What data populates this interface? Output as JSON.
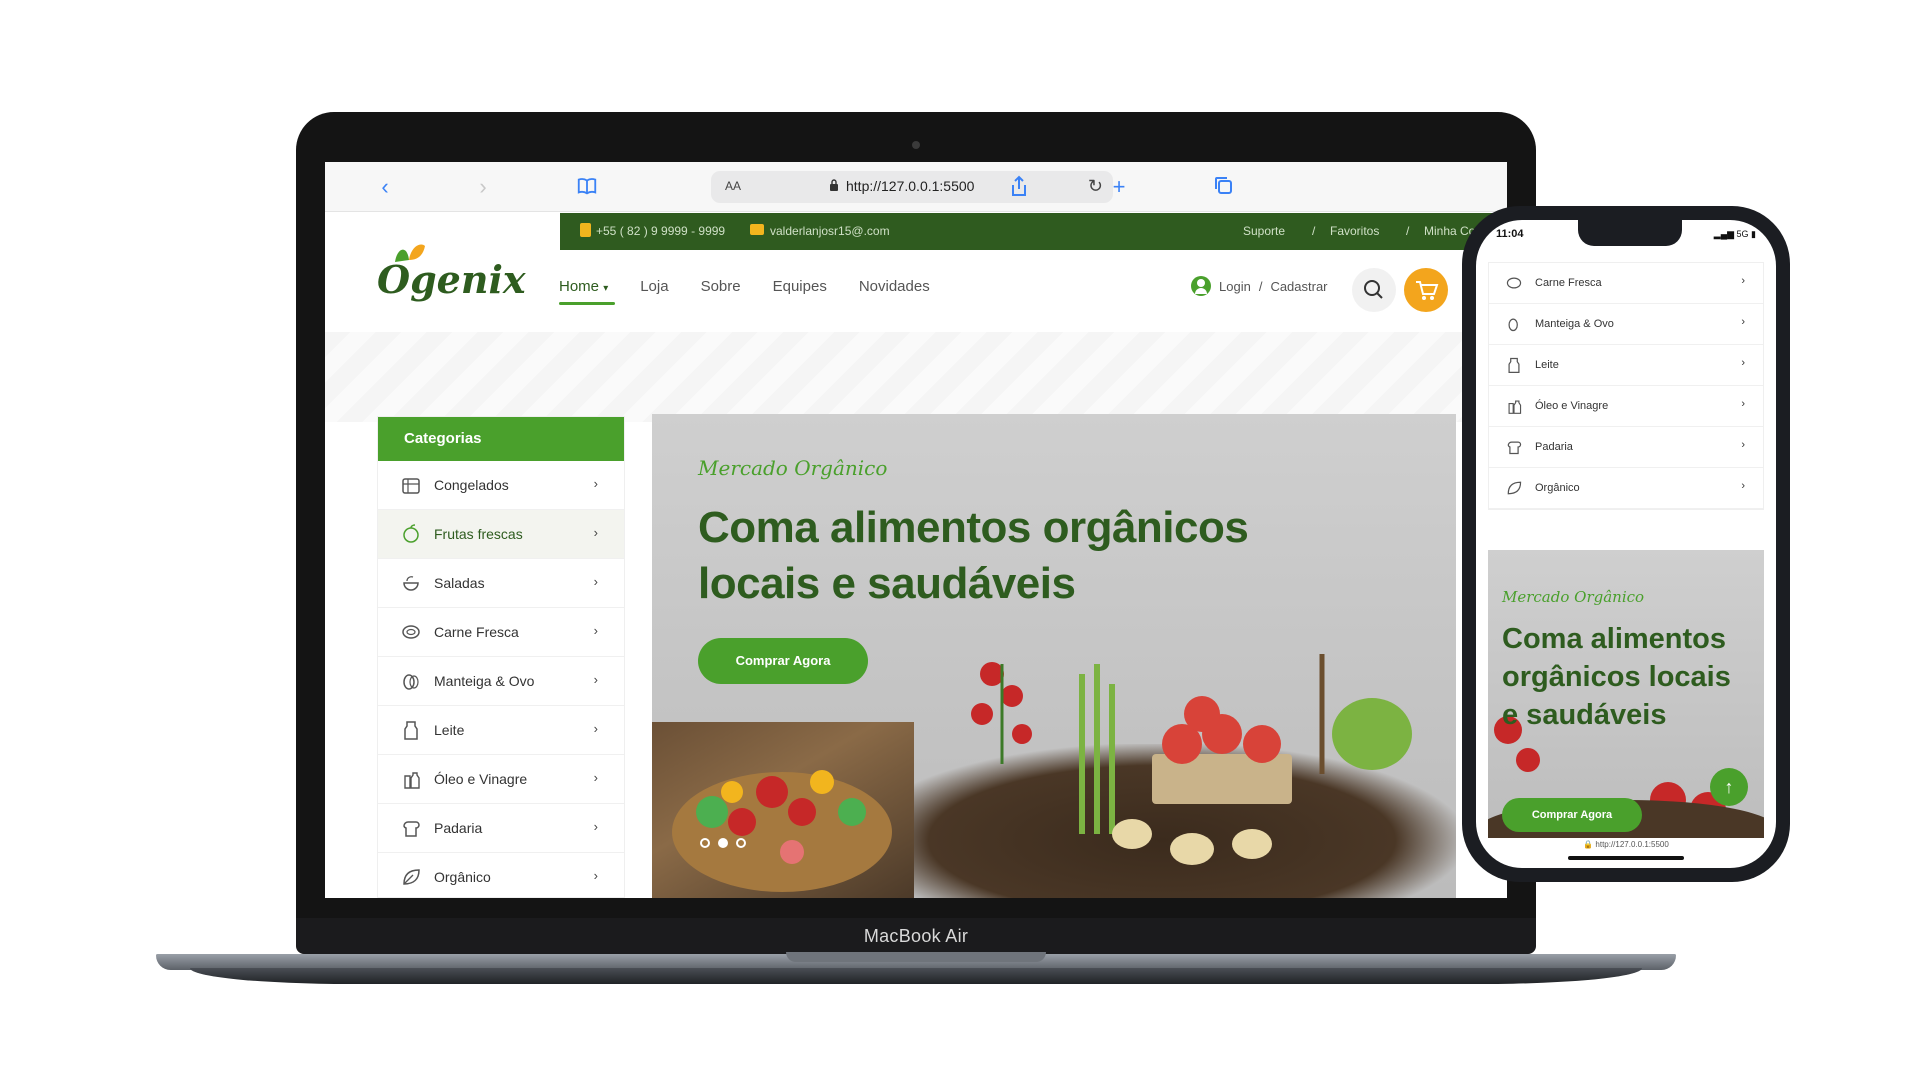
{
  "browser": {
    "url": "http://127.0.0.1:5500",
    "text_size_label": "AA"
  },
  "topbar": {
    "phone": "+55 ( 82 ) 9 9999 - 9999",
    "email": "valderlanjosr15@.com",
    "links": [
      "Suporte",
      "/",
      "Favoritos",
      "/",
      "Minha Conta"
    ]
  },
  "header": {
    "logo": "Ogenix",
    "nav": [
      {
        "label": "Home",
        "active": true,
        "has_dropdown": true
      },
      {
        "label": "Loja"
      },
      {
        "label": "Sobre"
      },
      {
        "label": "Equipes"
      },
      {
        "label": "Novidades"
      }
    ],
    "login_label": "Login",
    "separator": "/",
    "register_label": "Cadastrar"
  },
  "sidebar": {
    "title": "Categorias",
    "items": [
      {
        "label": "Congelados",
        "icon": "frozen-icon"
      },
      {
        "label": "Frutas frescas",
        "icon": "fruit-icon",
        "highlighted": true
      },
      {
        "label": "Saladas",
        "icon": "salad-icon"
      },
      {
        "label": "Carne Fresca",
        "icon": "meat-icon"
      },
      {
        "label": "Manteiga & Ovo",
        "icon": "egg-icon"
      },
      {
        "label": "Leite",
        "icon": "milk-icon"
      },
      {
        "label": "Óleo e Vinagre",
        "icon": "oil-icon"
      },
      {
        "label": "Padaria",
        "icon": "bread-icon"
      },
      {
        "label": "Orgânico",
        "icon": "leaf-icon"
      }
    ]
  },
  "hero": {
    "tagline": "Mercado Orgânico",
    "title": "Coma alimentos orgânicos locais e saudáveis",
    "cta": "Comprar Agora",
    "slide_count": 3,
    "active_slide": 2
  },
  "device_label": "MacBook Air",
  "phone": {
    "time": "11:04",
    "status": "5G",
    "categories": [
      {
        "label": "Carne Fresca",
        "icon": "meat-icon"
      },
      {
        "label": "Manteiga & Ovo",
        "icon": "egg-icon"
      },
      {
        "label": "Leite",
        "icon": "milk-icon"
      },
      {
        "label": "Óleo e Vinagre",
        "icon": "oil-icon"
      },
      {
        "label": "Padaria",
        "icon": "bread-icon"
      },
      {
        "label": "Orgânico",
        "icon": "leaf-icon"
      }
    ],
    "hero_tagline": "Mercado Orgânico",
    "hero_title": "Coma alimentos orgânicos locais e saudáveis",
    "hero_cta": "Comprar Agora",
    "url": "http://127.0.0.1:5500"
  },
  "colors": {
    "brand_green": "#4aa02c",
    "dark_green": "#2e5c1f",
    "topbar_green": "#2f5b1f",
    "accent_orange": "#f3a51d"
  }
}
